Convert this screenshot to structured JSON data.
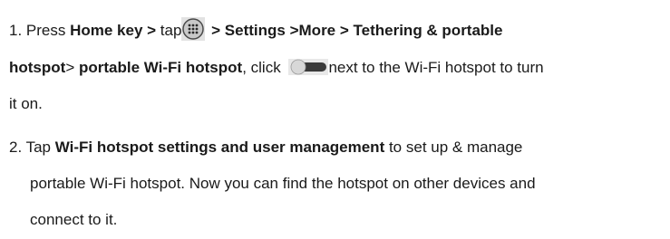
{
  "step1": {
    "line1": {
      "prefix": "1. Press ",
      "home_key": "Home key >",
      "tap": " tap",
      "settings_path": " > Settings >More > Tethering & portable"
    },
    "line2": {
      "hotspot": "hotspot",
      "sep": "> ",
      "portable_wifi": "portable Wi-Fi hotspot",
      "click": ", click ",
      "next": "next to the Wi-Fi hotspot to turn"
    },
    "line3": "it on."
  },
  "step2": {
    "line1": {
      "prefix": "2. Tap ",
      "bold": "Wi-Fi hotspot settings and user management",
      "suffix": " to set up & manage"
    },
    "line2": "portable Wi-Fi hotspot. Now you can find the hotspot on other devices and",
    "line3": "connect to it."
  },
  "icons": {
    "apps": "apps-grid-icon",
    "toggle": "toggle-switch-off-icon"
  },
  "colors": {
    "text": "#1a1a1a",
    "icon_bg": "#e2e2e2",
    "icon_circle": "#c9c9c9",
    "toggle_track": "#3a3a3a",
    "toggle_knob": "#d8d8d8"
  }
}
